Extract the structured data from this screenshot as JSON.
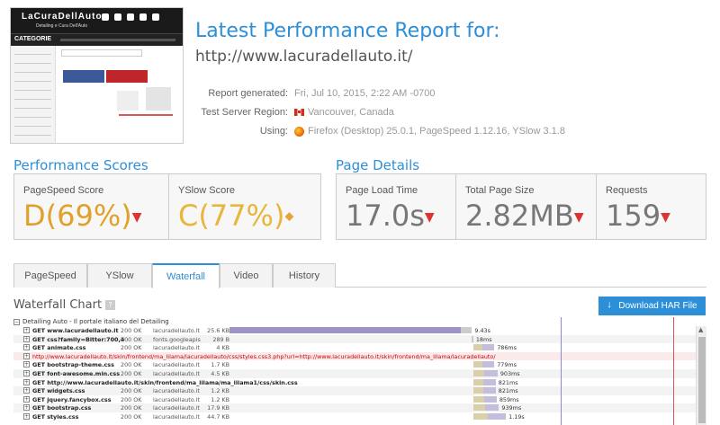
{
  "header": {
    "title": "Latest Performance Report for:",
    "url": "http://www.lacuradellauto.it/",
    "report_generated_label": "Report generated:",
    "report_generated_value": "Fri, Jul 10, 2015, 2:22 AM -0700",
    "region_label": "Test Server Region:",
    "region_value": "Vancouver, Canada",
    "using_label": "Using:",
    "using_value": "Firefox (Desktop) 25.0.1, PageSpeed 1.12.16, YSlow 3.1.8"
  },
  "thumbnail": {
    "logo_text": "LaCuraDellAuto",
    "subtitle": "Detailing e Cura Dell'Auto",
    "category_label": "CATEGORIE"
  },
  "performance": {
    "heading": "Performance Scores",
    "pagespeed_label": "PageSpeed Score",
    "pagespeed_value": "D(69%)",
    "yslow_label": "YSlow Score",
    "yslow_value": "C(77%)"
  },
  "details": {
    "heading": "Page Details",
    "load_label": "Page Load Time",
    "load_value": "17.0s",
    "size_label": "Total Page Size",
    "size_value": "2.82MB",
    "requests_label": "Requests",
    "requests_value": "159"
  },
  "tabs": [
    "PageSpeed",
    "YSlow",
    "Waterfall",
    "Video",
    "History"
  ],
  "active_tab": "Waterfall",
  "waterfall": {
    "title": "Waterfall Chart",
    "help": "?",
    "download_label": "Download HAR File",
    "group_label": "Detailing Auto - Il portale italiano del Detailing",
    "rows": [
      {
        "url": "GET www.lacuradellauto.it",
        "status": "200 OK",
        "domain": "lacuradellauto.it",
        "size": "25.6 KB",
        "time": "9.43s",
        "start": 0.0,
        "dur": 0.52
      },
      {
        "url": "GET css?family=Bitter:700,4",
        "status": "200 OK",
        "domain": "fonts.googleapis",
        "size": "289 B",
        "time": "18ms",
        "start": 0.52,
        "dur": 0.002
      },
      {
        "url": "GET animate.css",
        "status": "200 OK",
        "domain": "lacuradellauto.it",
        "size": "4 KB",
        "time": "786ms",
        "start": 0.523,
        "dur": 0.045
      },
      {
        "url": "http://www.lacuradellauto.it/skin/frontend/ma_lilama/lacuradellauto/css/styles.css3.php?url=http://www.lacuradellauto.it/skin/frontend/ma_lilama/lacuradellauto/",
        "status": "",
        "domain": "",
        "size": "",
        "time": "",
        "start": 0.0,
        "dur": 0.0,
        "redirect": true
      },
      {
        "url": "GET bootstrap-theme.css",
        "status": "200 OK",
        "domain": "lacuradellauto.it",
        "size": "1.7 KB",
        "time": "779ms",
        "start": 0.523,
        "dur": 0.045
      },
      {
        "url": "GET font-awesome.min.css",
        "status": "200 OK",
        "domain": "lacuradellauto.it",
        "size": "4.5 KB",
        "time": "903ms",
        "start": 0.523,
        "dur": 0.052
      },
      {
        "url": "GET http://www.lacuradellauto.it/skin/frontend/ma_lilama/ma_lilama1/css/skin.css",
        "status": "",
        "domain": "",
        "size": "",
        "time": "821ms",
        "start": 0.523,
        "dur": 0.048
      },
      {
        "url": "GET widgets.css",
        "status": "200 OK",
        "domain": "lacuradellauto.it",
        "size": "1.2 KB",
        "time": "821ms",
        "start": 0.523,
        "dur": 0.048
      },
      {
        "url": "GET jquery.fancybox.css",
        "status": "200 OK",
        "domain": "lacuradellauto.it",
        "size": "1.2 KB",
        "time": "859ms",
        "start": 0.523,
        "dur": 0.05
      },
      {
        "url": "GET bootstrap.css",
        "status": "200 OK",
        "domain": "lacuradellauto.it",
        "size": "17.9 KB",
        "time": "939ms",
        "start": 0.523,
        "dur": 0.055
      },
      {
        "url": "GET styles.css",
        "status": "200 OK",
        "domain": "lacuradellauto.it",
        "size": "44.7 KB",
        "time": "1.19s",
        "start": 0.523,
        "dur": 0.07
      }
    ]
  },
  "colors": {
    "accent": "#2c8fd8",
    "grade_d": "#e0a12b",
    "grade_c": "#e8b63a",
    "bar_main": "#9f92c4",
    "bar_wait": "#d9cfa8",
    "bar_recv": "#c3bedb"
  }
}
